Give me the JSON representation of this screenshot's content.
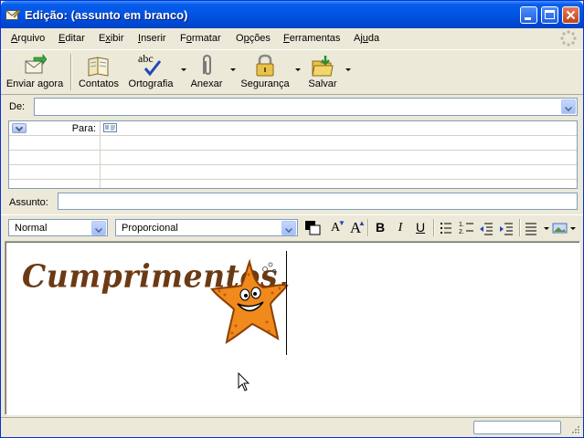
{
  "window": {
    "title": "Edição: (assunto em branco)",
    "icons": [
      "compose-icon",
      "minimize-icon",
      "maximize-icon",
      "close-icon"
    ]
  },
  "menu": {
    "items": [
      {
        "label": "Arquivo",
        "key": "A"
      },
      {
        "label": "Editar",
        "key": "E"
      },
      {
        "label": "Exibir",
        "key": "x"
      },
      {
        "label": "Inserir",
        "key": "I"
      },
      {
        "label": "Formatar",
        "key": "o"
      },
      {
        "label": "Opções",
        "key": "p"
      },
      {
        "label": "Ferramentas",
        "key": "F"
      },
      {
        "label": "Ajuda",
        "key": "u"
      }
    ]
  },
  "toolbar": {
    "send": "Enviar agora",
    "contacts": "Contatos",
    "spelling": "Ortografia",
    "spelling_glyph": "abc",
    "attach": "Anexar",
    "security": "Segurança",
    "save": "Salvar"
  },
  "header": {
    "from_label": "De:",
    "from_value": "",
    "to_label": "Para:",
    "subject_label": "Assunto:",
    "subject_value": ""
  },
  "format": {
    "paragraph_style": "Normal",
    "font": "Proporcional",
    "bold": "B",
    "italic": "I",
    "underline": "U",
    "text_color": "#000000",
    "smaller_glyph": "A",
    "larger_glyph": "A"
  },
  "body": {
    "greeting": "Cumprimentos,",
    "greeting_color": "#6B3A14",
    "image": "starfish-smiling-icon"
  },
  "colors": {
    "titlebar": "#0055E5",
    "chrome": "#ECE9D8",
    "close_button": "#C3421B"
  }
}
